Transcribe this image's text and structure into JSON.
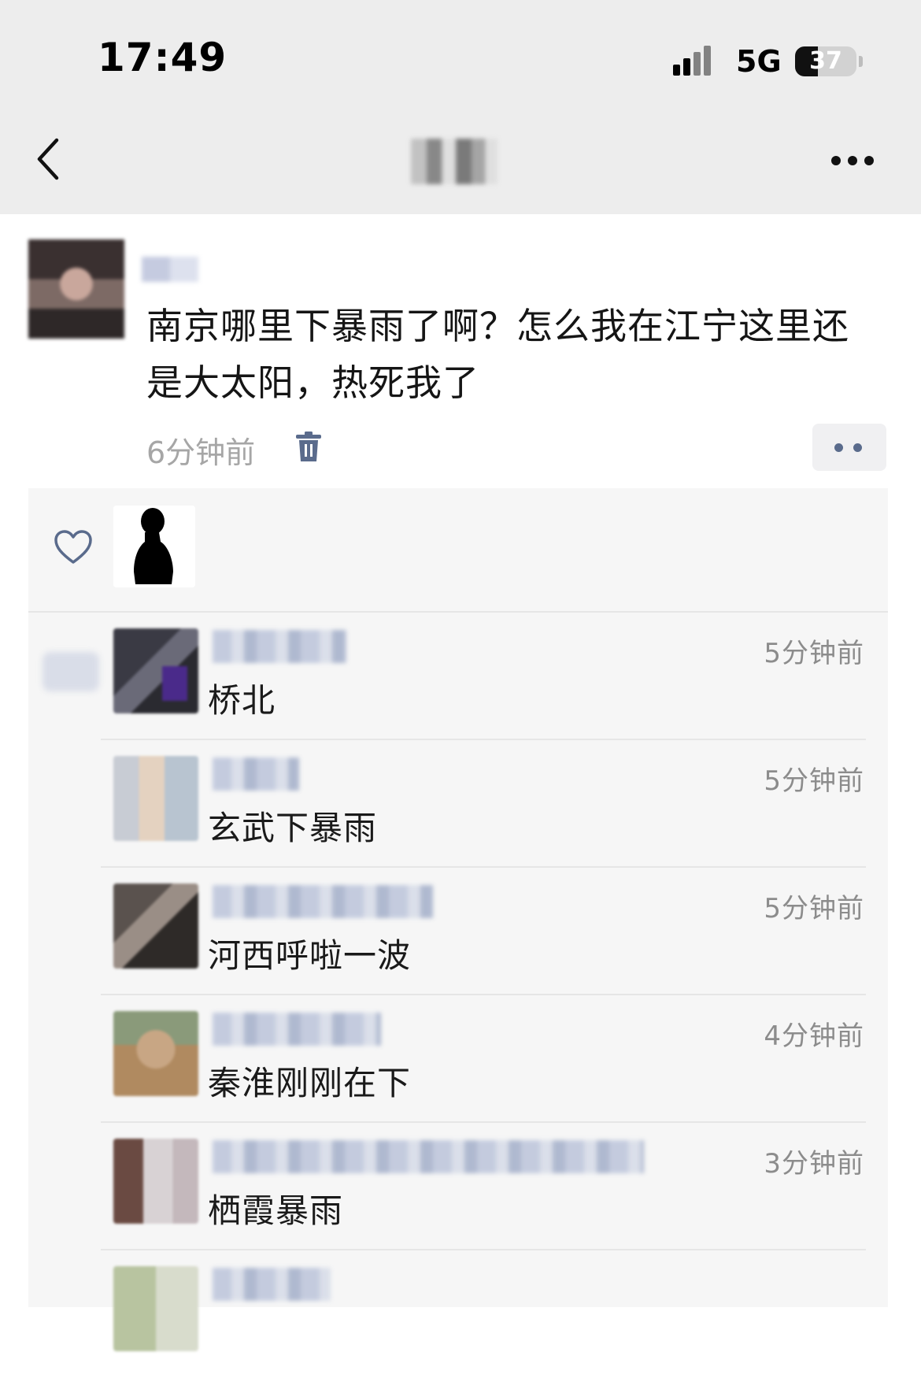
{
  "status_bar": {
    "time": "17:49",
    "network": "5G",
    "battery_percent": "37",
    "battery_level": 0.37
  },
  "nav": {
    "back_icon": "chevron-left-icon",
    "more_icon": "more-dots-icon"
  },
  "post": {
    "text": "南京哪里下暴雨了啊？怎么我在江宁这里还是大太阳，热死我了",
    "time": "6分钟前",
    "delete_icon": "trash-icon",
    "action_icon": "two-dots-icon"
  },
  "likes": {
    "icon": "heart-icon"
  },
  "comments": [
    {
      "time": "5分钟前",
      "text": "桥北"
    },
    {
      "time": "5分钟前",
      "text": "玄武下暴雨"
    },
    {
      "time": "5分钟前",
      "text": "河西呼啦一波"
    },
    {
      "time": "4分钟前",
      "text": "秦淮刚刚在下"
    },
    {
      "time": "3分钟前",
      "text": "栖霞暴雨"
    }
  ],
  "colors": {
    "topbar_bg": "#ededed",
    "comments_bg": "#f6f6f6",
    "link_blue": "#5a6b8c",
    "muted_text": "#a6a6a6"
  }
}
